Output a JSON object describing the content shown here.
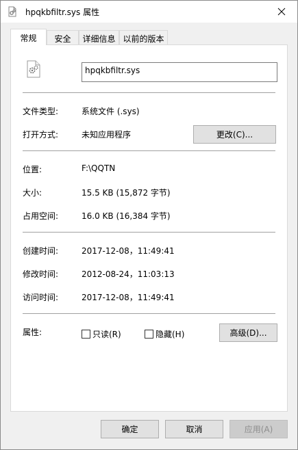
{
  "window": {
    "title": "hpqkbfiltr.sys 属性"
  },
  "tabs": [
    {
      "label": "常规"
    },
    {
      "label": "安全"
    },
    {
      "label": "详细信息"
    },
    {
      "label": "以前的版本"
    }
  ],
  "file": {
    "name": "hpqkbfiltr.sys"
  },
  "info": {
    "type_label": "文件类型:",
    "type_value": "系统文件 (.sys)",
    "opens_label": "打开方式:",
    "opens_value": "未知应用程序",
    "change_button": "更改(C)...",
    "location_label": "位置:",
    "location_value": "F:\\QQTN",
    "size_label": "大小:",
    "size_value": "15.5 KB (15,872 字节)",
    "disk_label": "占用空间:",
    "disk_value": "16.0 KB (16,384 字节)",
    "created_label": "创建时间:",
    "created_value": "2017-12-08，11:49:41",
    "modified_label": "修改时间:",
    "modified_value": "2012-08-24，11:03:13",
    "accessed_label": "访问时间:",
    "accessed_value": "2017-12-08，11:49:41",
    "attr_label": "属性:",
    "readonly_label": "只读(R)",
    "hidden_label": "隐藏(H)",
    "advanced_button": "高级(D)..."
  },
  "footer": {
    "ok": "确定",
    "cancel": "取消",
    "apply": "应用(A)"
  }
}
